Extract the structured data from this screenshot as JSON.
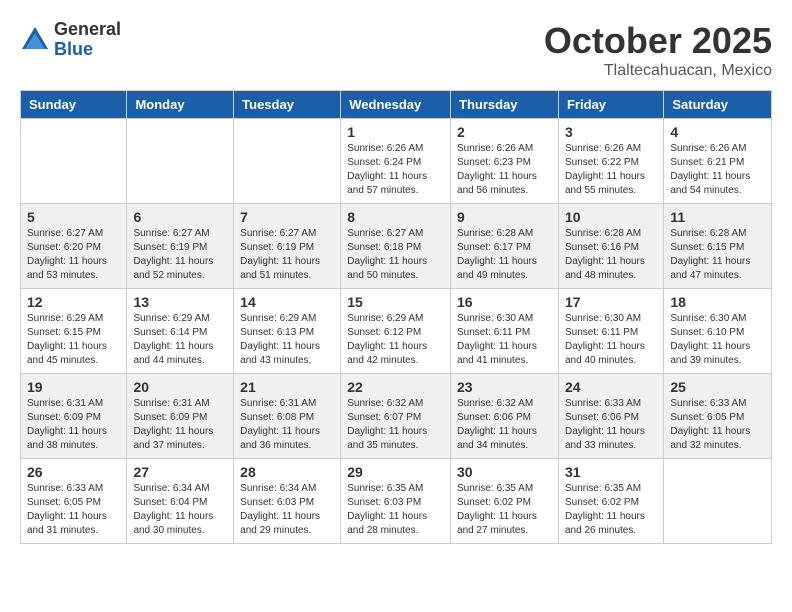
{
  "header": {
    "logo_general": "General",
    "logo_blue": "Blue",
    "month": "October 2025",
    "location": "Tlaltecahuacan, Mexico"
  },
  "days_of_week": [
    "Sunday",
    "Monday",
    "Tuesday",
    "Wednesday",
    "Thursday",
    "Friday",
    "Saturday"
  ],
  "weeks": [
    [
      {
        "day": "",
        "info": ""
      },
      {
        "day": "",
        "info": ""
      },
      {
        "day": "",
        "info": ""
      },
      {
        "day": "1",
        "info": "Sunrise: 6:26 AM\nSunset: 6:24 PM\nDaylight: 11 hours\nand 57 minutes."
      },
      {
        "day": "2",
        "info": "Sunrise: 6:26 AM\nSunset: 6:23 PM\nDaylight: 11 hours\nand 56 minutes."
      },
      {
        "day": "3",
        "info": "Sunrise: 6:26 AM\nSunset: 6:22 PM\nDaylight: 11 hours\nand 55 minutes."
      },
      {
        "day": "4",
        "info": "Sunrise: 6:26 AM\nSunset: 6:21 PM\nDaylight: 11 hours\nand 54 minutes."
      }
    ],
    [
      {
        "day": "5",
        "info": "Sunrise: 6:27 AM\nSunset: 6:20 PM\nDaylight: 11 hours\nand 53 minutes."
      },
      {
        "day": "6",
        "info": "Sunrise: 6:27 AM\nSunset: 6:19 PM\nDaylight: 11 hours\nand 52 minutes."
      },
      {
        "day": "7",
        "info": "Sunrise: 6:27 AM\nSunset: 6:19 PM\nDaylight: 11 hours\nand 51 minutes."
      },
      {
        "day": "8",
        "info": "Sunrise: 6:27 AM\nSunset: 6:18 PM\nDaylight: 11 hours\nand 50 minutes."
      },
      {
        "day": "9",
        "info": "Sunrise: 6:28 AM\nSunset: 6:17 PM\nDaylight: 11 hours\nand 49 minutes."
      },
      {
        "day": "10",
        "info": "Sunrise: 6:28 AM\nSunset: 6:16 PM\nDaylight: 11 hours\nand 48 minutes."
      },
      {
        "day": "11",
        "info": "Sunrise: 6:28 AM\nSunset: 6:15 PM\nDaylight: 11 hours\nand 47 minutes."
      }
    ],
    [
      {
        "day": "12",
        "info": "Sunrise: 6:29 AM\nSunset: 6:15 PM\nDaylight: 11 hours\nand 45 minutes."
      },
      {
        "day": "13",
        "info": "Sunrise: 6:29 AM\nSunset: 6:14 PM\nDaylight: 11 hours\nand 44 minutes."
      },
      {
        "day": "14",
        "info": "Sunrise: 6:29 AM\nSunset: 6:13 PM\nDaylight: 11 hours\nand 43 minutes."
      },
      {
        "day": "15",
        "info": "Sunrise: 6:29 AM\nSunset: 6:12 PM\nDaylight: 11 hours\nand 42 minutes."
      },
      {
        "day": "16",
        "info": "Sunrise: 6:30 AM\nSunset: 6:11 PM\nDaylight: 11 hours\nand 41 minutes."
      },
      {
        "day": "17",
        "info": "Sunrise: 6:30 AM\nSunset: 6:11 PM\nDaylight: 11 hours\nand 40 minutes."
      },
      {
        "day": "18",
        "info": "Sunrise: 6:30 AM\nSunset: 6:10 PM\nDaylight: 11 hours\nand 39 minutes."
      }
    ],
    [
      {
        "day": "19",
        "info": "Sunrise: 6:31 AM\nSunset: 6:09 PM\nDaylight: 11 hours\nand 38 minutes."
      },
      {
        "day": "20",
        "info": "Sunrise: 6:31 AM\nSunset: 6:09 PM\nDaylight: 11 hours\nand 37 minutes."
      },
      {
        "day": "21",
        "info": "Sunrise: 6:31 AM\nSunset: 6:08 PM\nDaylight: 11 hours\nand 36 minutes."
      },
      {
        "day": "22",
        "info": "Sunrise: 6:32 AM\nSunset: 6:07 PM\nDaylight: 11 hours\nand 35 minutes."
      },
      {
        "day": "23",
        "info": "Sunrise: 6:32 AM\nSunset: 6:06 PM\nDaylight: 11 hours\nand 34 minutes."
      },
      {
        "day": "24",
        "info": "Sunrise: 6:33 AM\nSunset: 6:06 PM\nDaylight: 11 hours\nand 33 minutes."
      },
      {
        "day": "25",
        "info": "Sunrise: 6:33 AM\nSunset: 6:05 PM\nDaylight: 11 hours\nand 32 minutes."
      }
    ],
    [
      {
        "day": "26",
        "info": "Sunrise: 6:33 AM\nSunset: 6:05 PM\nDaylight: 11 hours\nand 31 minutes."
      },
      {
        "day": "27",
        "info": "Sunrise: 6:34 AM\nSunset: 6:04 PM\nDaylight: 11 hours\nand 30 minutes."
      },
      {
        "day": "28",
        "info": "Sunrise: 6:34 AM\nSunset: 6:03 PM\nDaylight: 11 hours\nand 29 minutes."
      },
      {
        "day": "29",
        "info": "Sunrise: 6:35 AM\nSunset: 6:03 PM\nDaylight: 11 hours\nand 28 minutes."
      },
      {
        "day": "30",
        "info": "Sunrise: 6:35 AM\nSunset: 6:02 PM\nDaylight: 11 hours\nand 27 minutes."
      },
      {
        "day": "31",
        "info": "Sunrise: 6:35 AM\nSunset: 6:02 PM\nDaylight: 11 hours\nand 26 minutes."
      },
      {
        "day": "",
        "info": ""
      }
    ]
  ]
}
